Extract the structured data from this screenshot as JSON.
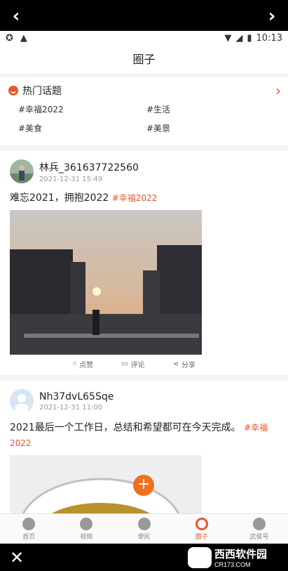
{
  "status": {
    "time": "10:13"
  },
  "title": "圈子",
  "topics": {
    "header": "热门话题",
    "items": [
      "#幸福2022",
      "#生活",
      "#美食",
      "#美景"
    ]
  },
  "posts": [
    {
      "name": "林兵_361637722560",
      "time": "2021-12-31 15:49",
      "text": "难忘2021，拥抱2022",
      "tag": "#幸福2022"
    },
    {
      "name": "Nh37dvL65Sqe",
      "time": "2021-12-31 11:00",
      "text": "2021最后一个工作日，总结和希望都可在今天完成。",
      "tag": "#幸福2022"
    }
  ],
  "actions": {
    "like": "点赞",
    "comment": "评论",
    "share": "分享"
  },
  "tabs": [
    "首页",
    "视频",
    "便民",
    "圈子",
    "武侯号"
  ],
  "watermark": {
    "brand": "西西软件园",
    "site": "CR173.COM"
  }
}
